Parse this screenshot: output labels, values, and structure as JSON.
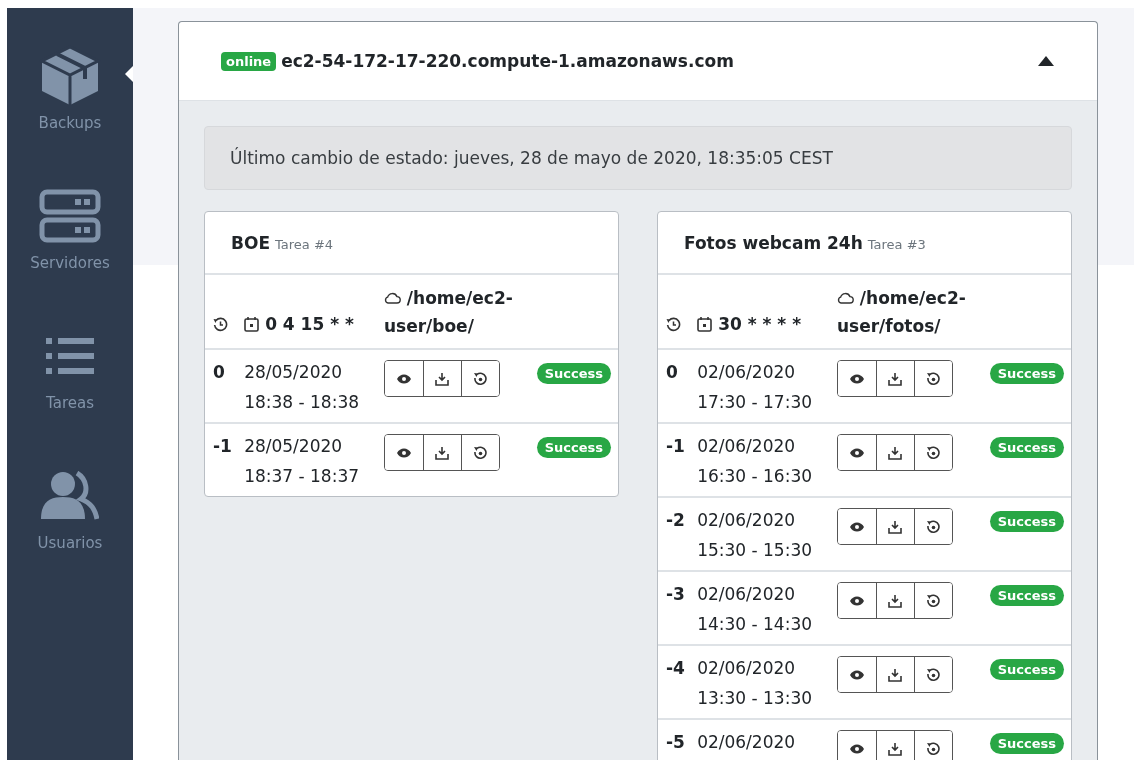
{
  "sidebar": {
    "items": [
      {
        "label": "Backups",
        "kind": "box",
        "selected": true
      },
      {
        "label": "Servidores",
        "kind": "server",
        "selected": false
      },
      {
        "label": "Tareas",
        "kind": "list",
        "selected": false
      },
      {
        "label": "Usuarios",
        "kind": "users",
        "selected": false
      }
    ]
  },
  "server": {
    "status": "online",
    "host": "ec2-54-172-17-220.compute-1.amazonaws.com",
    "expanded": true,
    "last_change": "Último cambio de estado: jueves, 28 de mayo de 2020, 18:35:05 CEST",
    "tasks": [
      {
        "name": "BOE",
        "task_id": "Tarea #4",
        "schedule": "0 4 15 * *",
        "path": "/home/ec2-user/boe/",
        "runs": [
          {
            "index": "0",
            "date": "28/05/2020",
            "time": "18:38 - 18:38",
            "status": "Success"
          },
          {
            "index": "-1",
            "date": "28/05/2020",
            "time": "18:37 - 18:37",
            "status": "Success"
          }
        ]
      },
      {
        "name": "Fotos webcam 24h",
        "task_id": "Tarea #3",
        "schedule": "30 * * * *",
        "path": "/home/ec2-user/fotos/",
        "runs": [
          {
            "index": "0",
            "date": "02/06/2020",
            "time": "17:30 - 17:30",
            "status": "Success"
          },
          {
            "index": "-1",
            "date": "02/06/2020",
            "time": "16:30 - 16:30",
            "status": "Success"
          },
          {
            "index": "-2",
            "date": "02/06/2020",
            "time": "15:30 - 15:30",
            "status": "Success"
          },
          {
            "index": "-3",
            "date": "02/06/2020",
            "time": "14:30 - 14:30",
            "status": "Success"
          },
          {
            "index": "-4",
            "date": "02/06/2020",
            "time": "13:30 - 13:30",
            "status": "Success"
          },
          {
            "index": "-5",
            "date": "02/06/2020",
            "status": "Success"
          }
        ]
      }
    ]
  }
}
